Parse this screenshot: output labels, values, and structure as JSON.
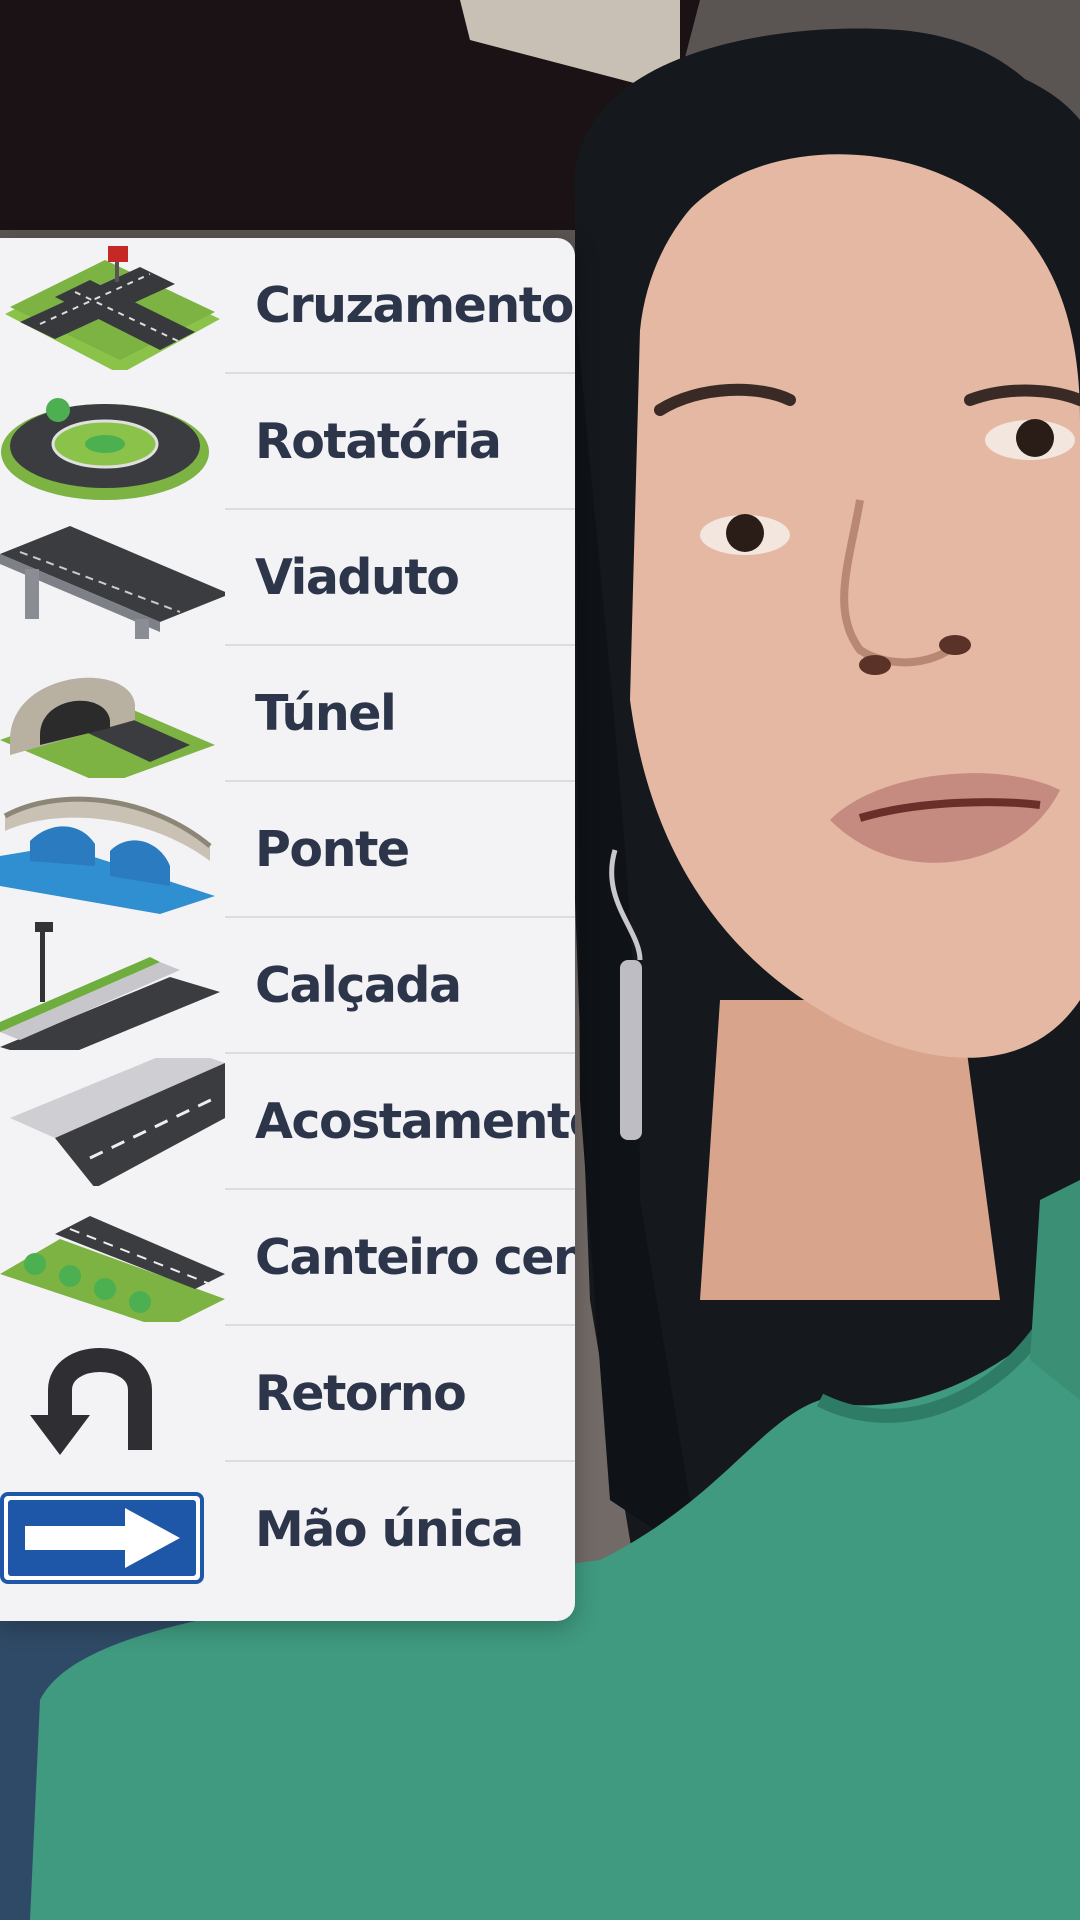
{
  "road_terms": {
    "items": [
      {
        "label": "Cruzamento",
        "icon": "crossroads-icon"
      },
      {
        "label": "Rotatória",
        "icon": "roundabout-icon"
      },
      {
        "label": "Viaduto",
        "icon": "overpass-icon"
      },
      {
        "label": "Túnel",
        "icon": "tunnel-icon"
      },
      {
        "label": "Ponte",
        "icon": "bridge-icon"
      },
      {
        "label": "Calçada",
        "icon": "sidewalk-icon"
      },
      {
        "label": "Acostamento",
        "icon": "road-shoulder-icon"
      },
      {
        "label": "Canteiro central",
        "icon": "median-strip-icon"
      },
      {
        "label": "Retorno",
        "icon": "u-turn-arrow-icon"
      },
      {
        "label": "Mão única",
        "icon": "one-way-sign-icon"
      }
    ]
  },
  "colors": {
    "card_background": "#f3f3f5",
    "label_text": "#2c3549",
    "sweater_green": "#3f9a7f",
    "one_way_sign_blue": "#1f57a8"
  }
}
